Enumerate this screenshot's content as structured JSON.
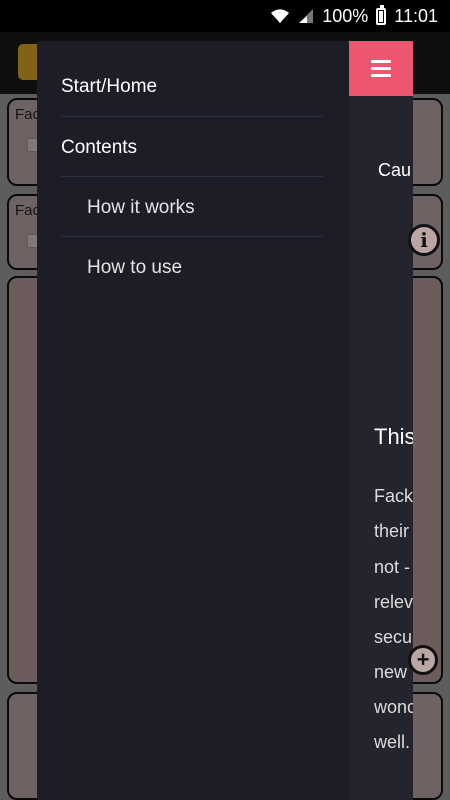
{
  "status_bar": {
    "battery_percent": "100%",
    "time": "11:01",
    "icons": [
      "wifi-icon",
      "signal-icon",
      "battery-icon"
    ]
  },
  "background": {
    "card1_label": "Fac",
    "card2_label": "Fac"
  },
  "drawer": {
    "menu": [
      {
        "label": "Start/Home",
        "level": 0
      },
      {
        "label": "Contents",
        "level": 0
      },
      {
        "label": "How it works",
        "level": 1
      },
      {
        "label": "How to use",
        "level": 1
      }
    ],
    "menu_icon": "hamburger-icon",
    "accent_color": "#ee566f"
  },
  "peek": {
    "button_text": "Cau",
    "heading": "This",
    "paragraph_lines": [
      "Fack",
      "their",
      "not -",
      "relev",
      "secu",
      "new",
      "wonc",
      "well."
    ]
  },
  "colors": {
    "drawer_bg": "#1c1d26",
    "peek_bg": "#23242e",
    "status_bar_bg": "#000000"
  }
}
